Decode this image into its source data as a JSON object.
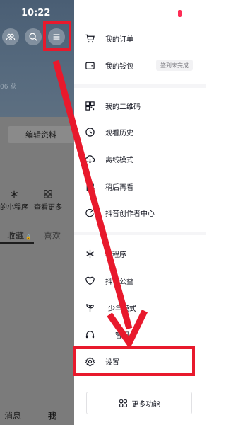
{
  "status_bar": {
    "time": "10:22"
  },
  "profile_background": {
    "faded_text": "06 获",
    "edit_profile": "编辑资料",
    "apps": [
      {
        "label": "的小程序",
        "icon": "asterisk-icon"
      },
      {
        "label": "查看更多",
        "icon": "grid-icon"
      }
    ],
    "tabs": {
      "active": "收藏",
      "active_lock": "🔒",
      "other": "喜欢"
    },
    "bottom_nav": {
      "messages": "消息",
      "me": "我"
    }
  },
  "drawer": {
    "items": [
      {
        "name": "my-orders",
        "label": "我的订单",
        "icon": "cart-icon"
      },
      {
        "name": "my-wallet",
        "label": "我的钱包",
        "icon": "wallet-icon"
      },
      {
        "name": "my-qrcode",
        "label": "我的二维码",
        "icon": "qrcode-icon"
      },
      {
        "name": "watch-history",
        "label": "观看历史",
        "icon": "clock-icon"
      },
      {
        "name": "offline-mode",
        "label": "离线模式",
        "icon": "cloud-download-icon"
      },
      {
        "name": "watch-later",
        "label": "稍后再看",
        "icon": "watch-later-icon"
      },
      {
        "name": "creator-center",
        "label": "抖音创作者中心",
        "icon": "creator-icon"
      },
      {
        "name": "mini-programs",
        "label": "小程序",
        "icon": "asterisk-icon"
      },
      {
        "name": "public-welfare",
        "label": "抖音公益",
        "icon": "heart-icon"
      },
      {
        "name": "teen-mode",
        "label": "少年模式",
        "icon": "sprout-icon"
      },
      {
        "name": "customer-service",
        "label": "客服",
        "icon": "headset-icon"
      },
      {
        "name": "settings",
        "label": "设置",
        "icon": "gear-icon"
      }
    ],
    "wallet_badge": "签到未完成",
    "more_features": "更多功能"
  },
  "colors": {
    "accent_red": "#e8192c",
    "badge_dot": "#fe2c55"
  }
}
